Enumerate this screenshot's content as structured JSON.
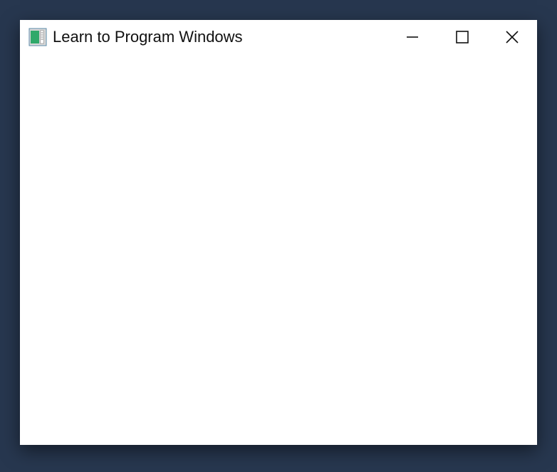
{
  "window": {
    "title": "Learn to Program Windows"
  }
}
